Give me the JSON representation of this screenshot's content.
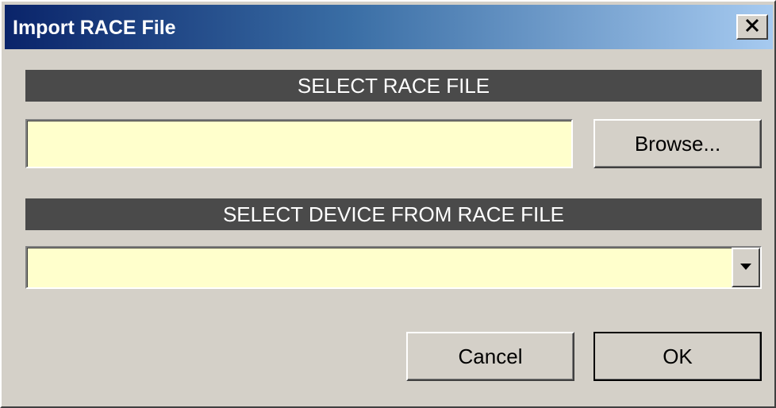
{
  "window": {
    "title": "Import RACE File"
  },
  "race_file_section": {
    "header": "SELECT RACE FILE",
    "file_path_value": "",
    "browse_label": "Browse..."
  },
  "device_section": {
    "header": "SELECT DEVICE FROM RACE FILE",
    "selected_device": ""
  },
  "actions": {
    "cancel_label": "Cancel",
    "ok_label": "OK"
  },
  "icons": {
    "close": "close-icon",
    "dropdown": "chevron-down-icon"
  },
  "colors": {
    "title_gradient_start": "#0a246a",
    "title_gradient_end": "#a6caf0",
    "section_bar": "#4a4a4a",
    "field_background": "#ffffcc",
    "dialog_background": "#d4d0c8"
  }
}
